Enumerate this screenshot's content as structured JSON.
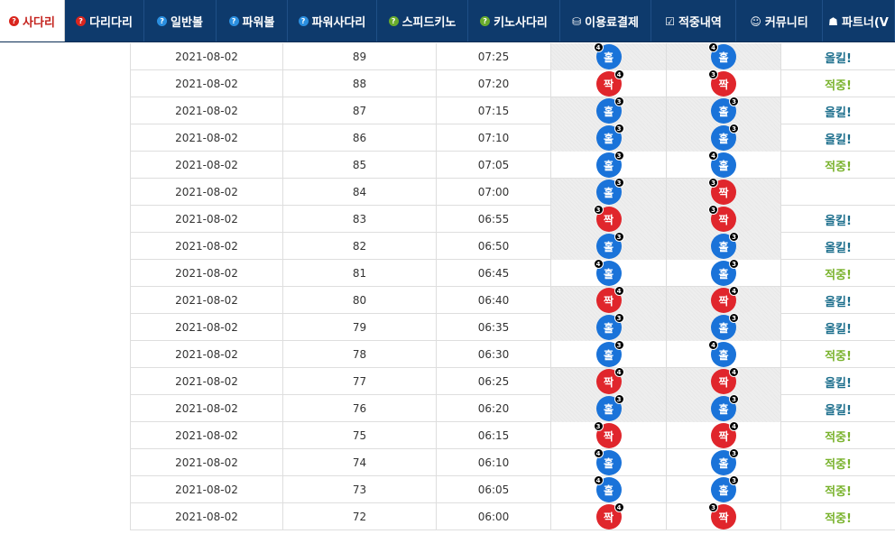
{
  "nav": {
    "tabs": [
      {
        "label": "사다리",
        "icon": "question-icon",
        "icon_glyph": "?",
        "icon_color": "#d9251d",
        "active": true,
        "width": 72
      },
      {
        "label": "다리다리",
        "icon": "question-icon",
        "icon_glyph": "?",
        "icon_color": "#d9251d",
        "width": 88
      },
      {
        "label": "일반볼",
        "icon": "question-icon",
        "icon_glyph": "?",
        "icon_color": "#2b8fe0",
        "width": 80
      },
      {
        "label": "파워볼",
        "icon": "question-icon",
        "icon_glyph": "?",
        "icon_color": "#2b8fe0",
        "width": 79
      },
      {
        "label": "파워사다리",
        "icon": "question-icon",
        "icon_glyph": "?",
        "icon_color": "#2b8fe0",
        "width": 99
      },
      {
        "label": "스피드키노",
        "icon": "question-icon",
        "icon_glyph": "?",
        "icon_color": "#6aac2c",
        "width": 101
      },
      {
        "label": "키노사다리",
        "icon": "question-icon",
        "icon_glyph": "?",
        "icon_color": "#6aac2c",
        "width": 102
      },
      {
        "label": "이용료결제",
        "icon": "database-icon",
        "icon_glyph": "⛁",
        "width": 101
      },
      {
        "label": "적중내역",
        "icon": "checkbox-icon",
        "icon_glyph": "☑",
        "width": 94
      },
      {
        "label": "커뮤니티",
        "icon": "smile-icon",
        "icon_glyph": "☺",
        "width": 96
      },
      {
        "label": "파트너(V",
        "icon": "users-icon",
        "icon_glyph": "☗",
        "width": 80
      }
    ]
  },
  "rows": [
    {
      "date": "2021-08-02",
      "round": "89",
      "time": "07:25",
      "b1": {
        "type": "홀",
        "count": "4",
        "pos": "left"
      },
      "b2": {
        "type": "홀",
        "count": "4",
        "pos": "left"
      },
      "result": "올킬!"
    },
    {
      "date": "2021-08-02",
      "round": "88",
      "time": "07:20",
      "b1": {
        "type": "짝",
        "count": "4",
        "pos": "right"
      },
      "b2": {
        "type": "짝",
        "count": "3",
        "pos": "left"
      },
      "result": "적중!"
    },
    {
      "date": "2021-08-02",
      "round": "87",
      "time": "07:15",
      "b1": {
        "type": "홀",
        "count": "3",
        "pos": "right"
      },
      "b2": {
        "type": "홀",
        "count": "3",
        "pos": "right"
      },
      "result": "올킬!"
    },
    {
      "date": "2021-08-02",
      "round": "86",
      "time": "07:10",
      "b1": {
        "type": "홀",
        "count": "3",
        "pos": "right"
      },
      "b2": {
        "type": "홀",
        "count": "3",
        "pos": "right"
      },
      "result": "올킬!"
    },
    {
      "date": "2021-08-02",
      "round": "85",
      "time": "07:05",
      "b1": {
        "type": "홀",
        "count": "3",
        "pos": "right"
      },
      "b2": {
        "type": "홀",
        "count": "4",
        "pos": "left"
      },
      "result": "적중!"
    },
    {
      "date": "2021-08-02",
      "round": "84",
      "time": "07:00",
      "b1": {
        "type": "홀",
        "count": "3",
        "pos": "right"
      },
      "b2": {
        "type": "짝",
        "count": "3",
        "pos": "left"
      },
      "result": ""
    },
    {
      "date": "2021-08-02",
      "round": "83",
      "time": "06:55",
      "b1": {
        "type": "짝",
        "count": "3",
        "pos": "left"
      },
      "b2": {
        "type": "짝",
        "count": "3",
        "pos": "left"
      },
      "result": "올킬!"
    },
    {
      "date": "2021-08-02",
      "round": "82",
      "time": "06:50",
      "b1": {
        "type": "홀",
        "count": "3",
        "pos": "right"
      },
      "b2": {
        "type": "홀",
        "count": "3",
        "pos": "right"
      },
      "result": "올킬!"
    },
    {
      "date": "2021-08-02",
      "round": "81",
      "time": "06:45",
      "b1": {
        "type": "홀",
        "count": "4",
        "pos": "left"
      },
      "b2": {
        "type": "홀",
        "count": "3",
        "pos": "right"
      },
      "result": "적중!"
    },
    {
      "date": "2021-08-02",
      "round": "80",
      "time": "06:40",
      "b1": {
        "type": "짝",
        "count": "4",
        "pos": "right"
      },
      "b2": {
        "type": "짝",
        "count": "4",
        "pos": "right"
      },
      "result": "올킬!"
    },
    {
      "date": "2021-08-02",
      "round": "79",
      "time": "06:35",
      "b1": {
        "type": "홀",
        "count": "3",
        "pos": "right"
      },
      "b2": {
        "type": "홀",
        "count": "3",
        "pos": "right"
      },
      "result": "올킬!"
    },
    {
      "date": "2021-08-02",
      "round": "78",
      "time": "06:30",
      "b1": {
        "type": "홀",
        "count": "3",
        "pos": "right"
      },
      "b2": {
        "type": "홀",
        "count": "4",
        "pos": "left"
      },
      "result": "적중!"
    },
    {
      "date": "2021-08-02",
      "round": "77",
      "time": "06:25",
      "b1": {
        "type": "짝",
        "count": "4",
        "pos": "right"
      },
      "b2": {
        "type": "짝",
        "count": "4",
        "pos": "right"
      },
      "result": "올킬!"
    },
    {
      "date": "2021-08-02",
      "round": "76",
      "time": "06:20",
      "b1": {
        "type": "홀",
        "count": "3",
        "pos": "right"
      },
      "b2": {
        "type": "홀",
        "count": "3",
        "pos": "right"
      },
      "result": "올킬!"
    },
    {
      "date": "2021-08-02",
      "round": "75",
      "time": "06:15",
      "b1": {
        "type": "짝",
        "count": "3",
        "pos": "left"
      },
      "b2": {
        "type": "짝",
        "count": "4",
        "pos": "right"
      },
      "result": "적중!"
    },
    {
      "date": "2021-08-02",
      "round": "74",
      "time": "06:10",
      "b1": {
        "type": "홀",
        "count": "4",
        "pos": "left"
      },
      "b2": {
        "type": "홀",
        "count": "3",
        "pos": "right"
      },
      "result": "적중!"
    },
    {
      "date": "2021-08-02",
      "round": "73",
      "time": "06:05",
      "b1": {
        "type": "홀",
        "count": "4",
        "pos": "left"
      },
      "b2": {
        "type": "홀",
        "count": "3",
        "pos": "right"
      },
      "result": "적중!"
    },
    {
      "date": "2021-08-02",
      "round": "72",
      "time": "06:00",
      "b1": {
        "type": "짝",
        "count": "4",
        "pos": "right"
      },
      "b2": {
        "type": "짝",
        "count": "3",
        "pos": "left"
      },
      "result": "적중!"
    }
  ]
}
